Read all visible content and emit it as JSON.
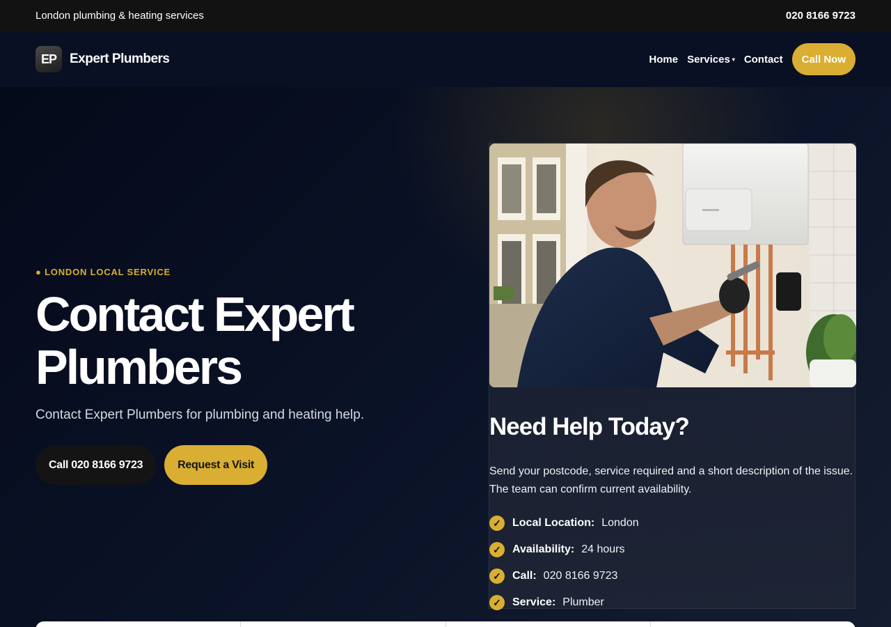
{
  "topbar": {
    "tagline": "London plumbing & heating services",
    "phone": "020 8166 9723"
  },
  "brand": {
    "logo_text": "EP",
    "name": "Expert Plumbers"
  },
  "nav": {
    "items": [
      {
        "label": "Home"
      },
      {
        "label": "Services",
        "caret": "▾"
      },
      {
        "label": "Contact"
      }
    ],
    "cta_label": "Call Now"
  },
  "hero": {
    "eyebrow": "● LONDON LOCAL SERVICE",
    "title_line1": "Contact Expert",
    "title_line2": "Plumbers",
    "subtitle": "Contact Expert Plumbers for plumbing and heating help.",
    "call_button": "Call 020 8166 9723",
    "visit_button": "Request a Visit"
  },
  "card": {
    "photo_icon": "plumber-photo",
    "title": "Need Help Today?",
    "text": "Send your postcode, service required and a short description of the issue. The team can confirm current availability.",
    "check_icon": "check-icon",
    "facts": [
      {
        "label": "Local Location:",
        "value": "London"
      },
      {
        "label": "Availability:",
        "value": "24 hours"
      },
      {
        "label": "Call:",
        "value": "020 8166 9723"
      },
      {
        "label": "Service:",
        "value": "Plumber"
      }
    ]
  },
  "colors": {
    "accent": "#d9ae32",
    "background": "#070c1d",
    "topbar": "#121212"
  }
}
